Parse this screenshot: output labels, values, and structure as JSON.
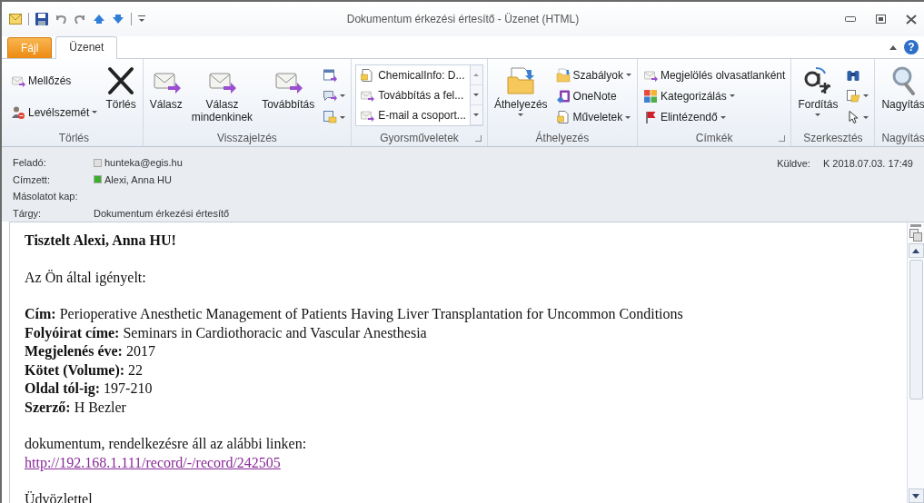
{
  "window": {
    "title": "Dokumentum érkezési értesítő - Üzenet (HTML)"
  },
  "tabs": [
    {
      "label": "Fájl",
      "kind": "file",
      "selected": false
    },
    {
      "label": "Üzenet",
      "kind": "tab",
      "selected": true
    }
  ],
  "help_button": "?",
  "ribbon": {
    "groups": [
      {
        "label": "Törlés",
        "launcher": false,
        "columns": [
          {
            "kind": "stack",
            "items": [
              {
                "label": "Mellőzés",
                "dropdown": false
              },
              {
                "label": "Levélszemét",
                "dropdown": true
              }
            ]
          },
          {
            "kind": "large",
            "label": "Törlés",
            "dropdown": false
          }
        ]
      },
      {
        "label": "Visszajelzés",
        "launcher": false,
        "columns": [
          {
            "kind": "large",
            "label": "Válasz",
            "dropdown": false
          },
          {
            "kind": "large",
            "label": "Válasz mindenkinek",
            "dropdown": false
          },
          {
            "kind": "large",
            "label": "Továbbítás",
            "dropdown": false
          },
          {
            "kind": "stack",
            "items": [
              {
                "dropdown": false
              },
              {
                "dropdown": true
              },
              {
                "dropdown": true
              }
            ]
          }
        ]
      },
      {
        "label": "Gyorsműveletek",
        "launcher": true,
        "columns": [
          {
            "kind": "gallery",
            "items": [
              {
                "label": "ChemicalInfo: D..."
              },
              {
                "label": "Továbbítás a fel..."
              },
              {
                "label": "E-mail a csoport..."
              }
            ]
          }
        ]
      },
      {
        "label": "Áthelyezés",
        "launcher": false,
        "columns": [
          {
            "kind": "large",
            "label": "Áthelyezés",
            "dropdown": true
          },
          {
            "kind": "stack",
            "items": [
              {
                "label": "Szabályok",
                "dropdown": true
              },
              {
                "label": "OneNote",
                "dropdown": false
              },
              {
                "label": "Műveletek",
                "dropdown": true
              }
            ]
          }
        ]
      },
      {
        "label": "Címkék",
        "launcher": true,
        "columns": [
          {
            "kind": "stack",
            "items": [
              {
                "label": "Megjelölés olvasatlanként",
                "dropdown": false
              },
              {
                "label": "Kategorizálás",
                "dropdown": true
              },
              {
                "label": "Elintézendő",
                "dropdown": true
              }
            ]
          }
        ]
      },
      {
        "label": "Szerkesztés",
        "launcher": false,
        "columns": [
          {
            "kind": "large",
            "label": "Fordítás",
            "dropdown": true
          },
          {
            "kind": "stack",
            "items": [
              {
                "dropdown": false
              },
              {
                "dropdown": true
              },
              {
                "dropdown": true
              }
            ]
          }
        ]
      },
      {
        "label": "Nagyítás",
        "launcher": false,
        "columns": [
          {
            "kind": "large",
            "label": "Nagyítás",
            "dropdown": false
          }
        ]
      }
    ]
  },
  "header": {
    "fields": [
      {
        "label": "Feladó:",
        "value": "hunteka@egis.hu",
        "color": "#e0e0e0"
      },
      {
        "label": "Címzett:",
        "value": "Alexi, Anna HU",
        "color": "#3cb02c"
      },
      {
        "label": "Másolatot kap:"
      },
      {
        "label": "Tárgy:",
        "value": "Dokumentum érkezési értesítő"
      }
    ],
    "sent": {
      "label": "Küldve:",
      "value": "K 2018.07.03. 17:49"
    }
  },
  "body": {
    "paragraphs": [
      {
        "lines": [
          {
            "kind": "greeting",
            "text": "Tisztelt Alexi, Anna HU!"
          }
        ]
      },
      {
        "lines": [
          {
            "kind": "text",
            "text": "Az Ön által igényelt:"
          }
        ]
      },
      {
        "lines": [
          {
            "kind": "text",
            "text": "**Cím:** Perioperative Anesthetic Management of Patients Having Liver Transplantation for Uncommon Conditions"
          },
          {
            "kind": "text",
            "text": "**Folyóirat címe:** Seminars in Cardiothoracic and Vascular Anesthesia"
          },
          {
            "kind": "text",
            "text": "**Megjelenés éve:** 2017"
          },
          {
            "kind": "text",
            "text": "**Kötet (Volume):** 22"
          },
          {
            "kind": "text",
            "text": "**Oldal tól-ig:** 197-210"
          },
          {
            "kind": "text",
            "text": "**Szerző:** H Bezler"
          }
        ]
      },
      {
        "lines": [
          {
            "kind": "text",
            "text": "dokumentum, rendelkezésre áll az alábbi linken:"
          },
          {
            "kind": "link",
            "text": "http://192.168.1.111/record/-/record/242505"
          }
        ]
      },
      {
        "lines": [
          {
            "kind": "text",
            "text": "Üdvözlettel"
          }
        ]
      }
    ]
  }
}
